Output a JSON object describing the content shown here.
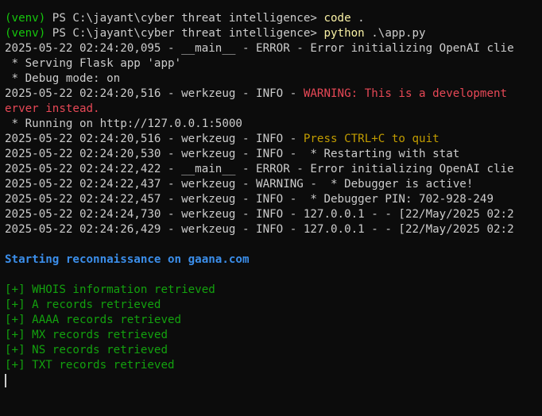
{
  "colors": {
    "background": "#0c0c0c",
    "text": "#cccccc",
    "venv": "#16c60c",
    "command": "#f9f1a5",
    "warning_red": "#e74856",
    "hint_yellow": "#c19c00",
    "recon_blue": "#3b8eea",
    "success_green": "#13a10e"
  },
  "prompt": {
    "venv": "(venv)",
    "ps": " PS C:\\jayant\\cyber threat intelligence> "
  },
  "commands": {
    "cmd1_name": "code",
    "cmd1_args": " .",
    "cmd2_name": "python",
    "cmd2_args": " .\\app.py"
  },
  "log": {
    "l1": "2025-05-22 02:24:20,095 - __main__ - ERROR - Error initializing OpenAI clie",
    "l2": " * Serving Flask app 'app'",
    "l3": " * Debug mode: on",
    "l4_prefix": "2025-05-22 02:24:20,516 - werkzeug - INFO - ",
    "l4_warn": "WARNING: This is a development",
    "l5_warn": "erver instead.",
    "l6": " * Running on http://127.0.0.1:5000",
    "l7_prefix": "2025-05-22 02:24:20,516 - werkzeug - INFO - ",
    "l7_hint": "Press CTRL+C to quit",
    "l8": "2025-05-22 02:24:20,530 - werkzeug - INFO -  * Restarting with stat",
    "l9": "2025-05-22 02:24:22,422 - __main__ - ERROR - Error initializing OpenAI clie",
    "l10": "2025-05-22 02:24:22,437 - werkzeug - WARNING -  * Debugger is active!",
    "l11": "2025-05-22 02:24:22,457 - werkzeug - INFO -  * Debugger PIN: 702-928-249",
    "l12": "2025-05-22 02:24:24,730 - werkzeug - INFO - 127.0.0.1 - - [22/May/2025 02:2",
    "l13": "2025-05-22 02:24:26,429 - werkzeug - INFO - 127.0.0.1 - - [22/May/2025 02:2"
  },
  "recon": {
    "heading": "Starting reconnaissance on gaana.com",
    "results": [
      "[+] WHOIS information retrieved",
      "[+] A records retrieved",
      "[+] AAAA records retrieved",
      "[+] MX records retrieved",
      "[+] NS records retrieved",
      "[+] TXT records retrieved"
    ]
  }
}
